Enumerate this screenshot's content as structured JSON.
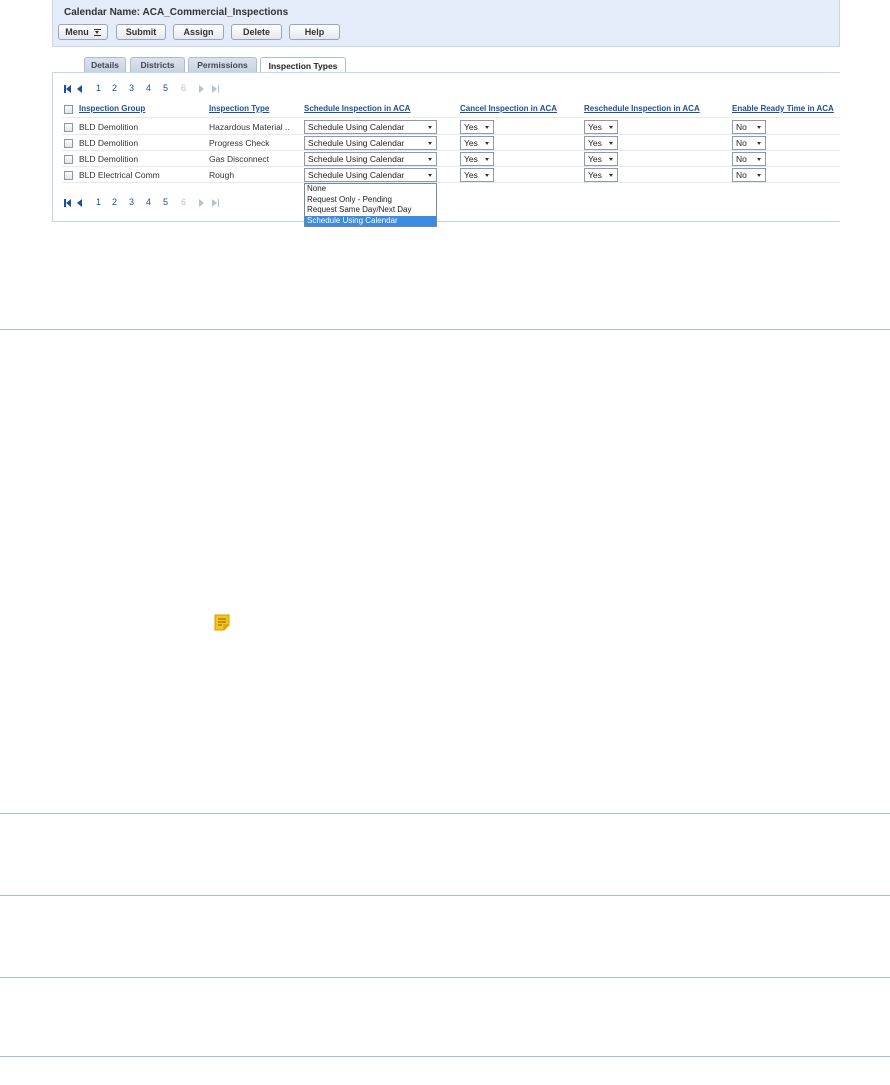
{
  "header": {
    "calendar_title": "Calendar Name: ACA_Commercial_Inspections",
    "buttons": {
      "menu": "Menu",
      "submit": "Submit",
      "assign": "Assign",
      "delete": "Delete",
      "help": "Help"
    }
  },
  "tabs": [
    "Details",
    "Districts",
    "Permissions",
    "Inspection Types"
  ],
  "active_tab": "Inspection Types",
  "pagination": {
    "pages": [
      "1",
      "2",
      "3",
      "4",
      "5",
      "6"
    ],
    "current_page": "1",
    "disabled_page": "6"
  },
  "table": {
    "columns": [
      "Inspection Group",
      "Inspection Type",
      "Schedule Inspection in ACA",
      "Cancel Inspection in ACA",
      "Reschedule Inspection in ACA",
      "Enable Ready Time in ACA"
    ],
    "rows": [
      {
        "group": "BLD Demolition",
        "type": "Hazardous Material ..",
        "schedule": "Schedule Using Calendar",
        "cancel": "Yes",
        "reschedule": "Yes",
        "ready_time": "No"
      },
      {
        "group": "BLD Demolition",
        "type": "Progress Check",
        "schedule": "Schedule Using Calendar",
        "cancel": "Yes",
        "reschedule": "Yes",
        "ready_time": "No"
      },
      {
        "group": "BLD Demolition",
        "type": "Gas Disconnect",
        "schedule": "Schedule Using Calendar",
        "cancel": "Yes",
        "reschedule": "Yes",
        "ready_time": "No"
      },
      {
        "group": "BLD Electrical Comm",
        "type": "Rough",
        "schedule": "Schedule Using Calendar",
        "cancel": "Yes",
        "reschedule": "Yes",
        "ready_time": "No"
      }
    ]
  },
  "schedule_dropdown": {
    "options": [
      "None",
      "Request Only - Pending",
      "Request Same Day/Next Day",
      "Schedule Using Calendar"
    ],
    "highlighted": "Schedule Using Calendar"
  },
  "colors": {
    "header_bg": "#e3ecf8",
    "link_blue": "#1b4fa0",
    "highlight": "#3b8be0",
    "note_icon": "#f5c518"
  },
  "icons": {
    "note": "note-icon"
  }
}
